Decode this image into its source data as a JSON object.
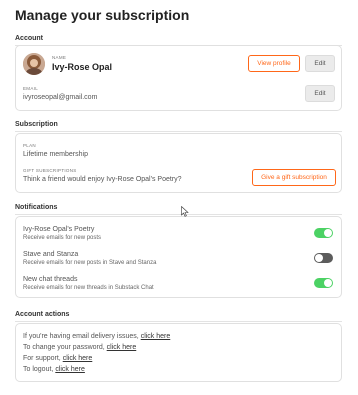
{
  "page": {
    "title": "Manage your subscription"
  },
  "account": {
    "heading": "Account",
    "name_label": "NAME",
    "name": "Ivy-Rose Opal",
    "view_profile_label": "View profile",
    "edit_name_label": "Edit",
    "email_label": "EMAIL",
    "email": "ivyroseopal@gmail.com",
    "edit_email_label": "Edit"
  },
  "subscription": {
    "heading": "Subscription",
    "plan_label": "PLAN",
    "plan": "Lifetime membership",
    "gift_label": "GIFT SUBSCRIPTIONS",
    "gift_text": "Think a friend would enjoy Ivy-Rose Opal's Poetry?",
    "gift_button_label": "Give a gift subscription"
  },
  "notifications": {
    "heading": "Notifications",
    "items": [
      {
        "title": "Ivy-Rose Opal's Poetry",
        "desc": "Receive emails for new posts",
        "on": true
      },
      {
        "title": "Stave and Stanza",
        "desc": "Receive emails for new posts in Stave and Stanza",
        "on": false
      },
      {
        "title": "New chat threads",
        "desc": "Receive emails for new threads in Substack Chat",
        "on": true
      }
    ]
  },
  "account_actions": {
    "heading": "Account actions",
    "rows": [
      {
        "text": "If you're having email delivery issues,",
        "link": "click here"
      },
      {
        "text": "To change your password,",
        "link": "click here"
      },
      {
        "text": "For support,",
        "link": "click here"
      },
      {
        "text": "To logout,",
        "link": "click here"
      }
    ]
  },
  "colors": {
    "accent": "#ff6719",
    "toggle_on": "#4cd264",
    "toggle_off": "#5c5c5c"
  }
}
